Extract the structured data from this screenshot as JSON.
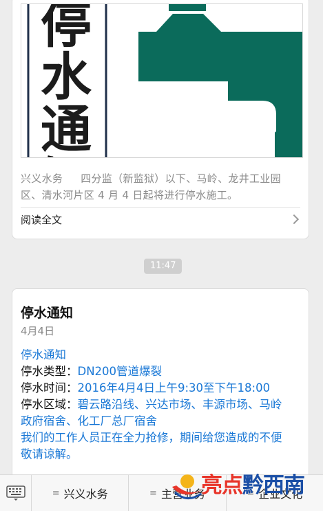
{
  "article": {
    "cover": {
      "vertical_text": "停水通知",
      "accent_color": "#0b6b5b"
    },
    "excerpt_source": "兴义水务",
    "excerpt_text": "四分监（新监狱）以下、马岭、龙井工业园区、清水河片区 4 月 4 日起将进行停水施工。",
    "read_more_label": "阅读全文"
  },
  "timestamp": "11:47",
  "notice": {
    "title": "停水通知",
    "date": "4月4日",
    "lines": {
      "heading": "停水通知",
      "type_label": "停水类型：",
      "type_value": "DN200管道爆裂",
      "time_label": "停水时间：",
      "time_value": "2016年4月4日上午9:30至下午18:00",
      "area_label": "停水区域：",
      "area_value_1": "碧云路沿线、兴达市场、丰源市场、马岭",
      "area_value_2": "政府宿舍、化工厂总厂宿舍",
      "apology_1": "我们的工作人员正在全力抢修，期间给您造成的不便",
      "apology_2": "敬请谅解。"
    }
  },
  "menu": {
    "items": [
      {
        "label": "兴义水务"
      },
      {
        "label": "主营业务"
      },
      {
        "label": "企业文化"
      }
    ]
  },
  "watermark": {
    "part1": "亮点",
    "part2": "黔西南"
  },
  "colors": {
    "link_blue": "#1a78d6",
    "cover_green": "#0b6b5b",
    "watermark_red": "#e8352a",
    "watermark_blue": "#1b4fa6"
  }
}
